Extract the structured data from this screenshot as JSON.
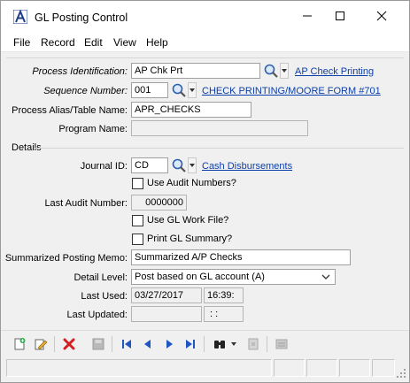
{
  "window": {
    "title": "GL Posting Control",
    "controls": {
      "minimize_icon": "minimize-icon",
      "maximize_icon": "maximize-icon",
      "close_icon": "close-icon"
    }
  },
  "menu": [
    "File",
    "Record",
    "Edit",
    "View",
    "Help"
  ],
  "form": {
    "process_id": {
      "label": "Process Identification:",
      "value": "AP Chk Prt",
      "link": "AP Check Printing"
    },
    "sequence": {
      "label": "Sequence Number:",
      "value": "001",
      "link": "CHECK PRINTING/MOORE FORM #701"
    },
    "alias": {
      "label": "Process Alias/Table Name:",
      "value": "APR_CHECKS"
    },
    "program": {
      "label": "Program Name:",
      "value": ""
    },
    "details_label": "Details",
    "journal": {
      "label": "Journal ID:",
      "value": "CD",
      "link": "Cash Disbursements"
    },
    "use_audit": {
      "label": "Use Audit Numbers?",
      "checked": false
    },
    "last_audit": {
      "label": "Last Audit Number:",
      "value": "0000000"
    },
    "use_gl_work": {
      "label": "Use GL Work File?",
      "checked": false
    },
    "print_summary": {
      "label": "Print GL Summary?",
      "checked": false
    },
    "memo": {
      "label": "Summarized Posting Memo:",
      "value": "Summarized A/P Checks"
    },
    "detail_level": {
      "label": "Detail Level:",
      "value": "Post based on GL account (A)"
    },
    "last_used": {
      "label": "Last Used:",
      "date": "03/27/2017",
      "time": "16:39:"
    },
    "last_updated": {
      "label": "Last Updated:",
      "date": "",
      "time": " :  :"
    }
  },
  "colors": {
    "link": "#0b3ea8",
    "accent": "#1f56c0",
    "delete_red": "#d42020"
  }
}
